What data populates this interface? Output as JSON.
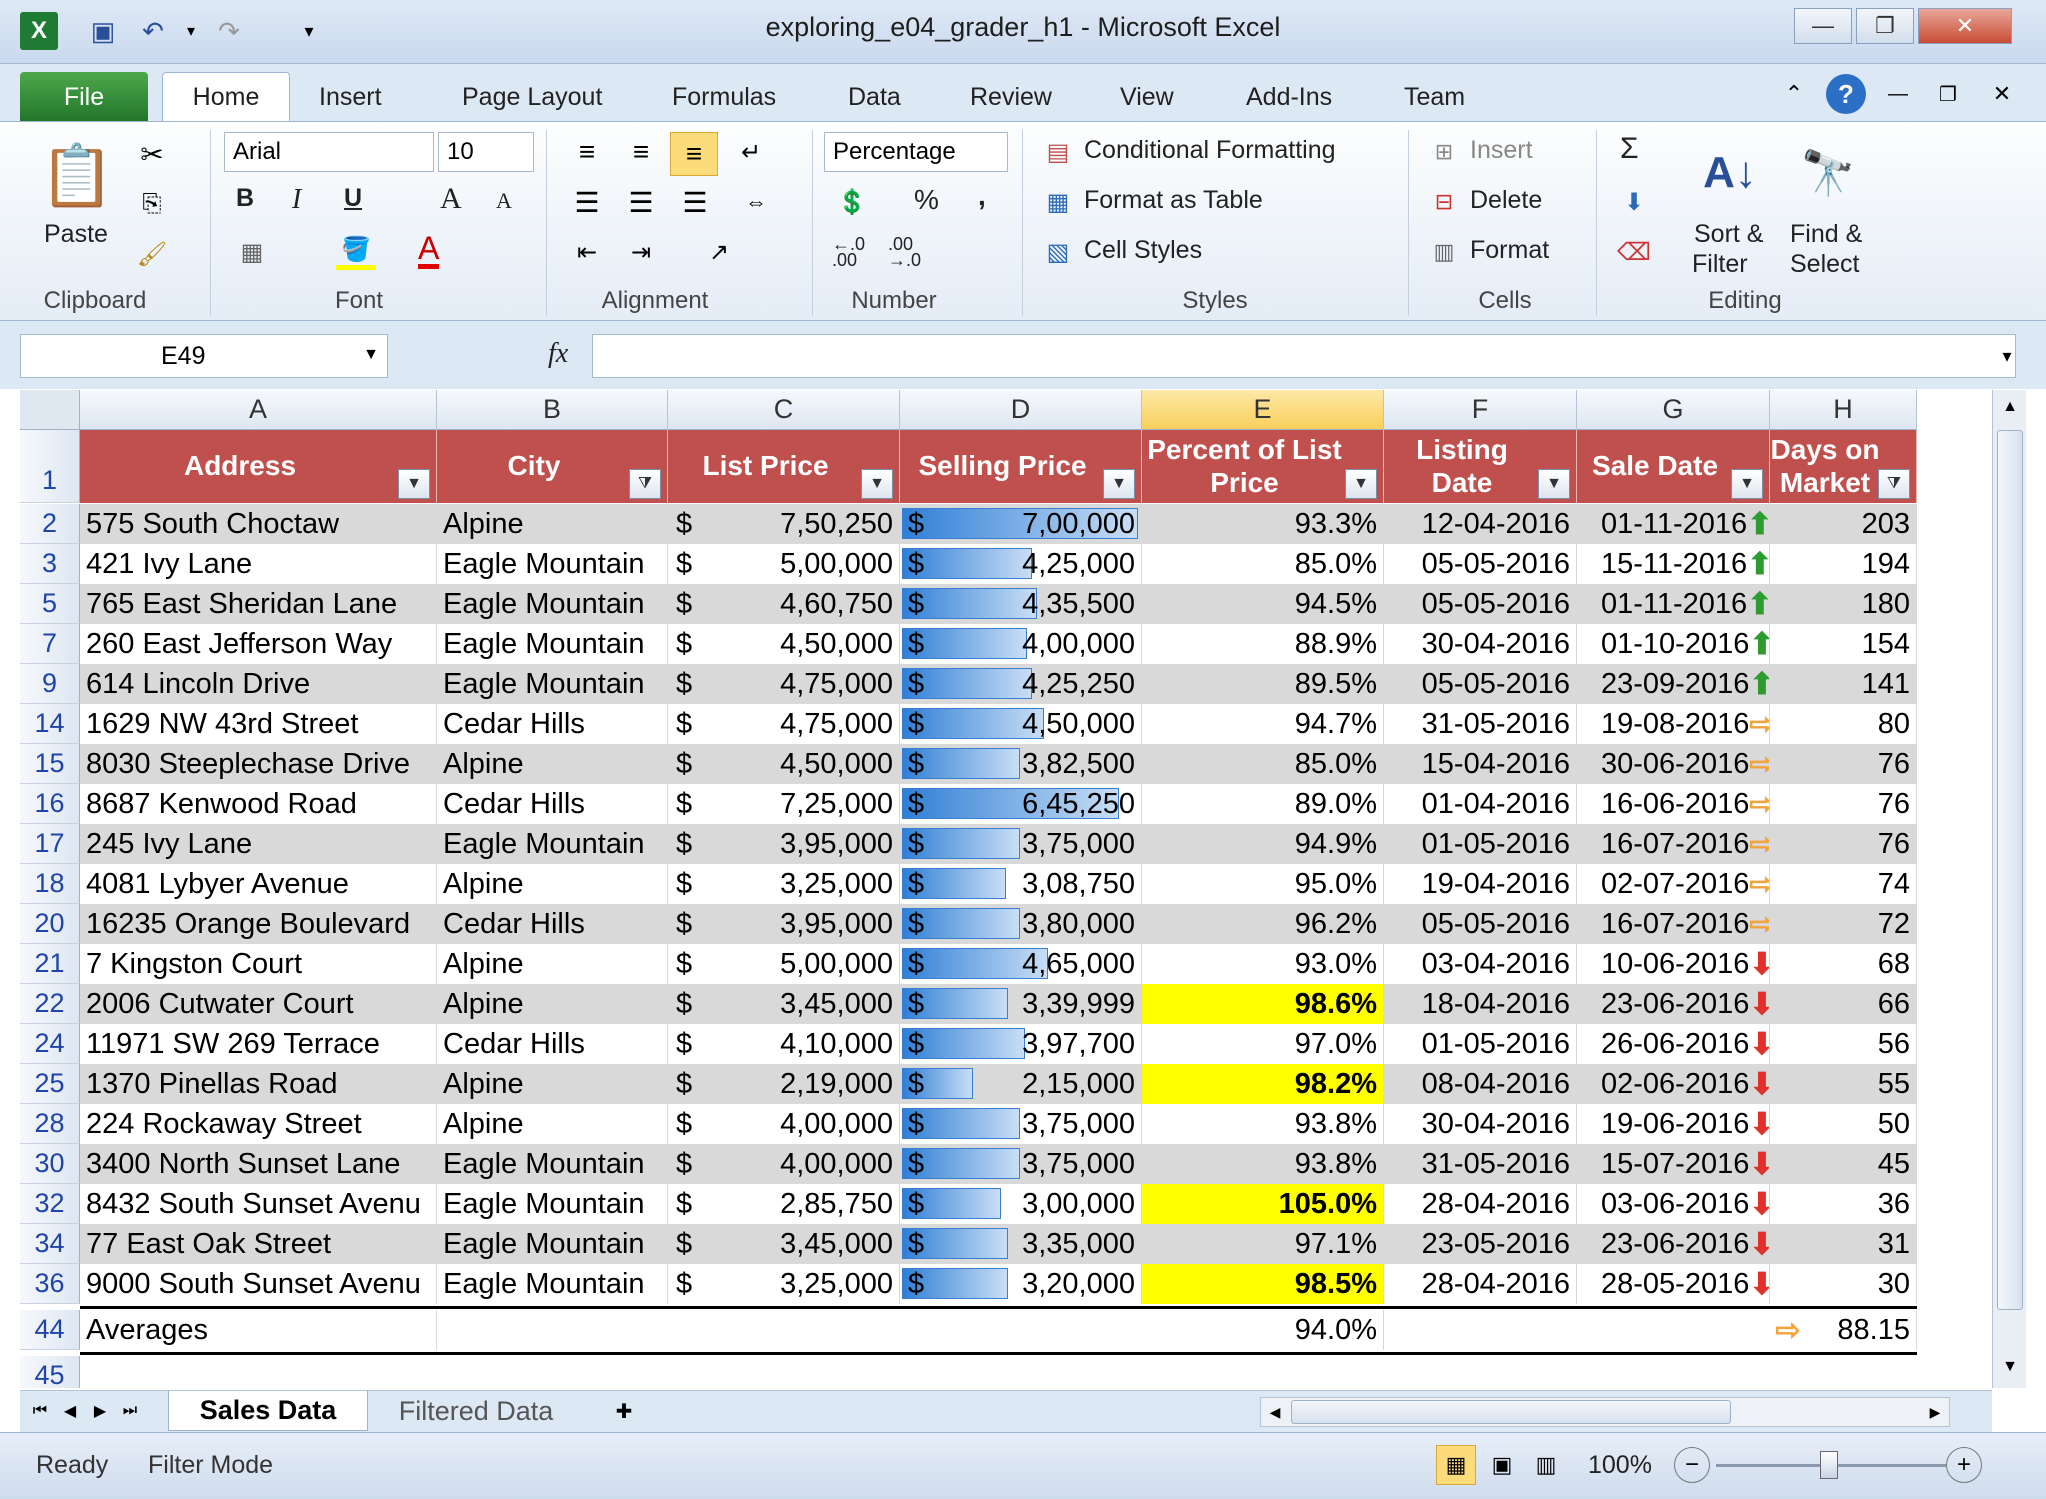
{
  "window": {
    "title": "exploring_e04_grader_h1  -  Microsoft Excel",
    "minimize_icon": "minimize-icon",
    "restore_icon": "restore-icon",
    "close_icon": "close-icon"
  },
  "ribbon_tabs": [
    "File",
    "Home",
    "Insert",
    "Page Layout",
    "Formulas",
    "Data",
    "Review",
    "View",
    "Add-Ins",
    "Team"
  ],
  "ribbon": {
    "clipboard": {
      "paste": "Paste",
      "label": "Clipboard"
    },
    "font": {
      "name": "Arial",
      "size": "10",
      "label": "Font",
      "bold": "B",
      "italic": "I",
      "underline": "U",
      "grow": "A",
      "shrink": "A",
      "color": "A"
    },
    "alignment": {
      "label": "Alignment"
    },
    "number": {
      "format": "Percentage",
      "percent": "%",
      "comma": ",",
      "inc": "←.0 .00",
      "dec": ".00 →.0",
      "label": "Number"
    },
    "styles": {
      "cond": "Conditional Formatting",
      "table": "Format as Table",
      "cell": "Cell Styles",
      "label": "Styles"
    },
    "cells": {
      "insert": "Insert",
      "delete": "Delete",
      "format": "Format",
      "label": "Cells"
    },
    "editing": {
      "sigma": "Σ",
      "sort": "Sort &",
      "sort2": "Filter",
      "find": "Find &",
      "find2": "Select",
      "label": "Editing"
    }
  },
  "formula_bar": {
    "name_box": "E49",
    "fx": "fx",
    "value": ""
  },
  "columns": [
    "A",
    "B",
    "C",
    "D",
    "E",
    "F",
    "G",
    "H"
  ],
  "headers": {
    "address": "Address",
    "city": "City",
    "list_price": "List Price",
    "selling_price": "Selling Price",
    "percent": "Percent of List Price",
    "listing_date": "Listing Date",
    "sale_date": "Sale Date",
    "days": "Days on Market"
  },
  "rows": [
    {
      "n": "2",
      "address": "575 South Choctaw",
      "city": "Alpine",
      "list": "7,50,250",
      "sell": "7,00,000",
      "bar": 1.0,
      "pct": "93.3%",
      "ld": "12-04-2016",
      "sd": "01-11-2016",
      "arrow": "up",
      "days": "203",
      "hl": false
    },
    {
      "n": "3",
      "address": "421 Ivy Lane",
      "city": "Eagle Mountain",
      "list": "5,00,000",
      "sell": "4,25,000",
      "bar": 0.55,
      "pct": "85.0%",
      "ld": "05-05-2016",
      "sd": "15-11-2016",
      "arrow": "up",
      "days": "194",
      "hl": false
    },
    {
      "n": "5",
      "address": "765 East Sheridan Lane",
      "city": "Eagle Mountain",
      "list": "4,60,750",
      "sell": "4,35,500",
      "bar": 0.57,
      "pct": "94.5%",
      "ld": "05-05-2016",
      "sd": "01-11-2016",
      "arrow": "up",
      "days": "180",
      "hl": false
    },
    {
      "n": "7",
      "address": "260 East Jefferson Way",
      "city": "Eagle Mountain",
      "list": "4,50,000",
      "sell": "4,00,000",
      "bar": 0.53,
      "pct": "88.9%",
      "ld": "30-04-2016",
      "sd": "01-10-2016",
      "arrow": "up",
      "days": "154",
      "hl": false
    },
    {
      "n": "9",
      "address": "614 Lincoln Drive",
      "city": "Eagle Mountain",
      "list": "4,75,000",
      "sell": "4,25,250",
      "bar": 0.55,
      "pct": "89.5%",
      "ld": "05-05-2016",
      "sd": "23-09-2016",
      "arrow": "up",
      "days": "141",
      "hl": false
    },
    {
      "n": "14",
      "address": "1629 NW 43rd Street",
      "city": "Cedar Hills",
      "list": "4,75,000",
      "sell": "4,50,000",
      "bar": 0.6,
      "pct": "94.7%",
      "ld": "31-05-2016",
      "sd": "19-08-2016",
      "arrow": "right",
      "days": "80",
      "hl": false
    },
    {
      "n": "15",
      "address": "8030 Steeplechase Drive",
      "city": "Alpine",
      "list": "4,50,000",
      "sell": "3,82,500",
      "bar": 0.5,
      "pct": "85.0%",
      "ld": "15-04-2016",
      "sd": "30-06-2016",
      "arrow": "right",
      "days": "76",
      "hl": false
    },
    {
      "n": "16",
      "address": "8687 Kenwood Road",
      "city": "Cedar Hills",
      "list": "7,25,000",
      "sell": "6,45,250",
      "bar": 0.92,
      "pct": "89.0%",
      "ld": "01-04-2016",
      "sd": "16-06-2016",
      "arrow": "right",
      "days": "76",
      "hl": false
    },
    {
      "n": "17",
      "address": "245 Ivy Lane",
      "city": "Eagle Mountain",
      "list": "3,95,000",
      "sell": "3,75,000",
      "bar": 0.5,
      "pct": "94.9%",
      "ld": "01-05-2016",
      "sd": "16-07-2016",
      "arrow": "right",
      "days": "76",
      "hl": false
    },
    {
      "n": "18",
      "address": "4081 Lybyer Avenue",
      "city": "Alpine",
      "list": "3,25,000",
      "sell": "3,08,750",
      "bar": 0.44,
      "pct": "95.0%",
      "ld": "19-04-2016",
      "sd": "02-07-2016",
      "arrow": "right",
      "days": "74",
      "hl": false
    },
    {
      "n": "20",
      "address": "16235 Orange Boulevard",
      "city": "Cedar Hills",
      "list": "3,95,000",
      "sell": "3,80,000",
      "bar": 0.5,
      "pct": "96.2%",
      "ld": "05-05-2016",
      "sd": "16-07-2016",
      "arrow": "right",
      "days": "72",
      "hl": false
    },
    {
      "n": "21",
      "address": "7 Kingston Court",
      "city": "Alpine",
      "list": "5,00,000",
      "sell": "4,65,000",
      "bar": 0.62,
      "pct": "93.0%",
      "ld": "03-04-2016",
      "sd": "10-06-2016",
      "arrow": "down",
      "days": "68",
      "hl": false
    },
    {
      "n": "22",
      "address": "2006 Cutwater Court",
      "city": "Alpine",
      "list": "3,45,000",
      "sell": "3,39,999",
      "bar": 0.45,
      "pct": "98.6%",
      "ld": "18-04-2016",
      "sd": "23-06-2016",
      "arrow": "down",
      "days": "66",
      "hl": true
    },
    {
      "n": "24",
      "address": "11971 SW 269 Terrace",
      "city": "Cedar Hills",
      "list": "4,10,000",
      "sell": "3,97,700",
      "bar": 0.52,
      "pct": "97.0%",
      "ld": "01-05-2016",
      "sd": "26-06-2016",
      "arrow": "down",
      "days": "56",
      "hl": false
    },
    {
      "n": "25",
      "address": "1370 Pinellas Road",
      "city": "Alpine",
      "list": "2,19,000",
      "sell": "2,15,000",
      "bar": 0.3,
      "pct": "98.2%",
      "ld": "08-04-2016",
      "sd": "02-06-2016",
      "arrow": "down",
      "days": "55",
      "hl": true
    },
    {
      "n": "28",
      "address": "224 Rockaway Street",
      "city": "Alpine",
      "list": "4,00,000",
      "sell": "3,75,000",
      "bar": 0.5,
      "pct": "93.8%",
      "ld": "30-04-2016",
      "sd": "19-06-2016",
      "arrow": "down",
      "days": "50",
      "hl": false
    },
    {
      "n": "30",
      "address": "3400 North Sunset Lane",
      "city": "Eagle Mountain",
      "list": "4,00,000",
      "sell": "3,75,000",
      "bar": 0.5,
      "pct": "93.8%",
      "ld": "31-05-2016",
      "sd": "15-07-2016",
      "arrow": "down",
      "days": "45",
      "hl": false
    },
    {
      "n": "32",
      "address": "8432 South Sunset Avenu",
      "city": "Eagle Mountain",
      "list": "2,85,750",
      "sell": "3,00,000",
      "bar": 0.42,
      "pct": "105.0%",
      "ld": "28-04-2016",
      "sd": "03-06-2016",
      "arrow": "down",
      "days": "36",
      "hl": true
    },
    {
      "n": "34",
      "address": "77 East Oak Street",
      "city": "Eagle Mountain",
      "list": "3,45,000",
      "sell": "3,35,000",
      "bar": 0.45,
      "pct": "97.1%",
      "ld": "23-05-2016",
      "sd": "23-06-2016",
      "arrow": "down",
      "days": "31",
      "hl": false
    },
    {
      "n": "36",
      "address": "9000 South Sunset Avenu",
      "city": "Eagle Mountain",
      "list": "3,25,000",
      "sell": "3,20,000",
      "bar": 0.45,
      "pct": "98.5%",
      "ld": "28-04-2016",
      "sd": "28-05-2016",
      "arrow": "down",
      "days": "30",
      "hl": true
    }
  ],
  "averages": {
    "n": "44",
    "label": "Averages",
    "pct": "94.0%",
    "days": "88.15",
    "arrow": "right"
  },
  "blank_row": "45",
  "header_row": "1",
  "currency": "$",
  "sheets": [
    "Sales Data",
    "Filtered Data"
  ],
  "status": {
    "ready": "Ready",
    "mode": "Filter Mode",
    "zoom": "100%"
  },
  "colors": {
    "header": "#c0504d",
    "highlight": "#ffff00",
    "bar": "#2f7fd6",
    "arrow_up": "#2e9b2e",
    "arrow_right": "#f2a33a",
    "arrow_down": "#e0322a"
  }
}
